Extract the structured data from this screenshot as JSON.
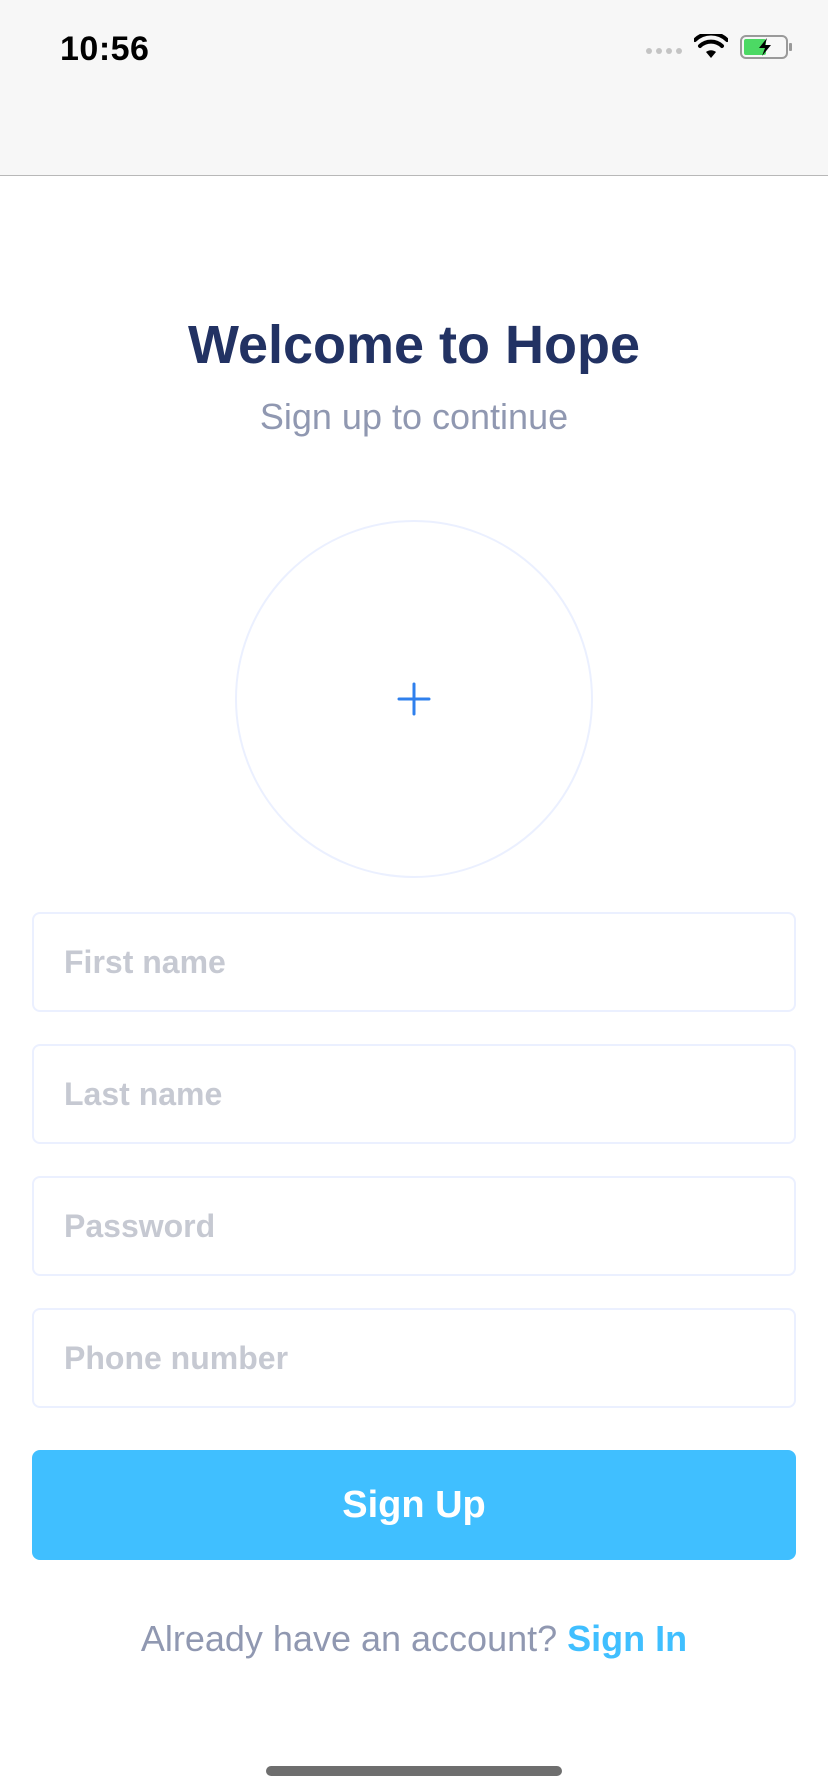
{
  "status_bar": {
    "time": "10:56",
    "icons": [
      "cellular-signal-icon",
      "wifi-icon",
      "battery-charging-icon"
    ]
  },
  "header": {
    "title": "Welcome to Hope",
    "subtitle": "Sign up to continue"
  },
  "avatar": {
    "icon": "plus-icon"
  },
  "form": {
    "first_name": {
      "placeholder": "First name",
      "value": ""
    },
    "last_name": {
      "placeholder": "Last name",
      "value": ""
    },
    "password": {
      "placeholder": "Password",
      "value": ""
    },
    "phone": {
      "placeholder": "Phone number",
      "value": ""
    },
    "submit_label": "Sign Up"
  },
  "footer": {
    "prompt": "Already have an account?",
    "link_label": "Sign In"
  },
  "colors": {
    "primary": "#40bfff",
    "title": "#223263",
    "muted": "#9098b1",
    "border": "#ebf0ff",
    "battery_green": "#4cd964"
  }
}
